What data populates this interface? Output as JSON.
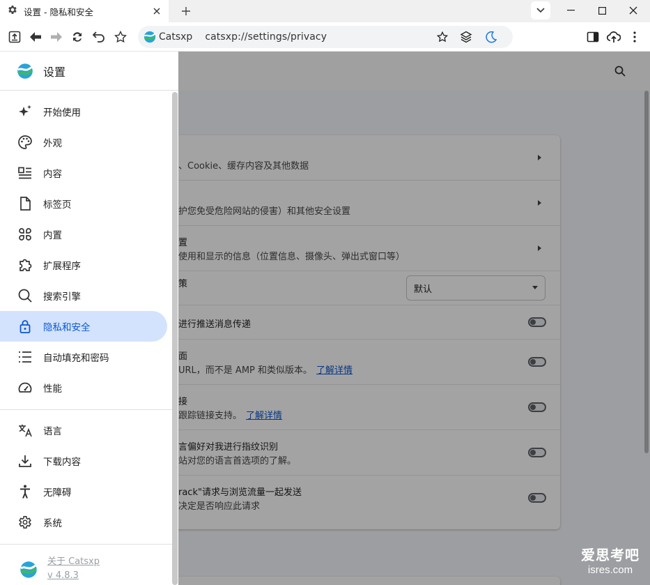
{
  "tab": {
    "title": "设置 - 隐私和安全"
  },
  "toolbar": {
    "brand": "Catsxp",
    "url": "catsxp://settings/privacy"
  },
  "drawer": {
    "title": "设置",
    "items": [
      {
        "label": "开始使用",
        "icon": "sparkle-icon"
      },
      {
        "label": "外观",
        "icon": "palette-icon"
      },
      {
        "label": "内容",
        "icon": "content-list-icon"
      },
      {
        "label": "标签页",
        "icon": "page-icon"
      },
      {
        "label": "内置",
        "icon": "grid-icon"
      },
      {
        "label": "扩展程序",
        "icon": "puzzle-icon"
      },
      {
        "label": "搜索引擎",
        "icon": "search-icon"
      },
      {
        "label": "隐私和安全",
        "icon": "lock-icon",
        "active": true
      },
      {
        "label": "自动填充和密码",
        "icon": "checklist-icon"
      },
      {
        "label": "性能",
        "icon": "gauge-icon"
      }
    ],
    "items2": [
      {
        "label": "语言",
        "icon": "translate-icon"
      },
      {
        "label": "下载内容",
        "icon": "download-icon"
      },
      {
        "label": "无障碍",
        "icon": "accessibility-icon"
      },
      {
        "label": "系统",
        "icon": "gear-icon"
      }
    ],
    "about": {
      "label": "关于 Catsxp",
      "version": "v 4.8.3"
    }
  },
  "card": {
    "rows": [
      {
        "title": "",
        "sub": "、Cookie、缓存内容及其他数据",
        "type": "arrow"
      },
      {
        "title": "",
        "sub": "护您免受危险网站的侵害）和其他安全设置",
        "type": "arrow"
      },
      {
        "title": "置",
        "sub": "使用和显示的信息（位置信息、摄像头、弹出式窗口等）",
        "type": "arrow"
      },
      {
        "title": "策",
        "sub": "",
        "type": "select",
        "value": "默认"
      },
      {
        "title": "进行推送消息传递",
        "sub": "",
        "type": "toggle"
      },
      {
        "title": "面",
        "sub": "URL，而不是 AMP 和类似版本。",
        "link": "了解详情",
        "type": "toggle"
      },
      {
        "title": "接",
        "sub": "跟踪链接支持。",
        "link": "了解详情",
        "type": "toggle"
      },
      {
        "title": "言偏好对我进行指纹识别",
        "sub": "站对您的语言首选项的了解。",
        "type": "toggle"
      },
      {
        "title": "rack\"请求与浏览流量一起发送",
        "sub": "决定是否响应此请求",
        "type": "toggle"
      }
    ]
  },
  "watermark": {
    "line1": "爱思考吧",
    "line2": "isres.com"
  },
  "colors": {
    "accent": "#0b57d0",
    "active_bg": "#d3e3fd"
  }
}
